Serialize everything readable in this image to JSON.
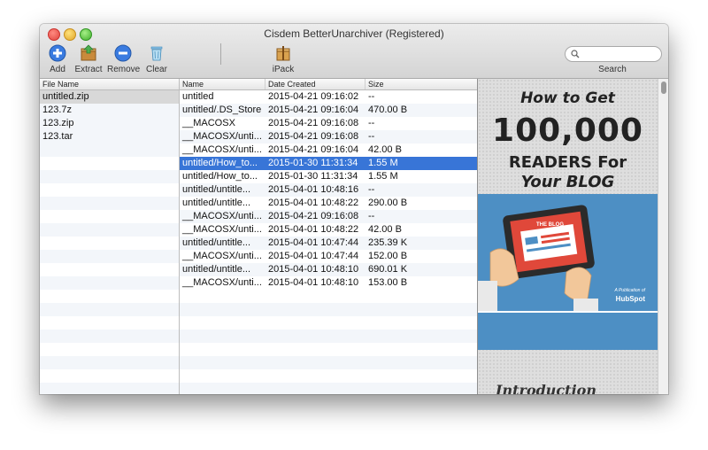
{
  "window": {
    "title": "Cisdem BetterUnarchiver (Registered)"
  },
  "toolbar": {
    "add_label": "Add",
    "extract_label": "Extract",
    "remove_label": "Remove",
    "clear_label": "Clear",
    "ipack_label": "iPack",
    "search_label": "Search",
    "search_value": ""
  },
  "archives": {
    "header": "File Name",
    "items": [
      "untitled.zip",
      "123.7z",
      "123.zip",
      "123.tar"
    ],
    "selected_index": 0
  },
  "files": {
    "headers": {
      "name": "Name",
      "date": "Date Created",
      "size": "Size"
    },
    "selected_index": 5,
    "rows": [
      {
        "name": "untitled",
        "date": "2015-04-21 09:16:02",
        "size": "--"
      },
      {
        "name": "untitled/.DS_Store",
        "date": "2015-04-21 09:16:04",
        "size": "470.00 B"
      },
      {
        "name": "__MACOSX",
        "date": "2015-04-21 09:16:08",
        "size": "--"
      },
      {
        "name": "__MACOSX/unti...",
        "date": "2015-04-21 09:16:08",
        "size": "--"
      },
      {
        "name": "__MACOSX/unti...",
        "date": "2015-04-21 09:16:04",
        "size": "42.00 B"
      },
      {
        "name": "untitled/How_to...",
        "date": "2015-01-30 11:31:34",
        "size": "1.55 M"
      },
      {
        "name": "untitled/How_to...",
        "date": "2015-01-30 11:31:34",
        "size": "1.55 M"
      },
      {
        "name": "untitled/untitle...",
        "date": "2015-04-01 10:48:16",
        "size": "--"
      },
      {
        "name": "untitled/untitle...",
        "date": "2015-04-01 10:48:22",
        "size": "290.00 B"
      },
      {
        "name": "__MACOSX/unti...",
        "date": "2015-04-21 09:16:08",
        "size": "--"
      },
      {
        "name": "__MACOSX/unti...",
        "date": "2015-04-01 10:48:22",
        "size": "42.00 B"
      },
      {
        "name": "untitled/untitle...",
        "date": "2015-04-01 10:47:44",
        "size": "235.39 K"
      },
      {
        "name": "__MACOSX/unti...",
        "date": "2015-04-01 10:47:44",
        "size": "152.00 B"
      },
      {
        "name": "untitled/untitle...",
        "date": "2015-04-01 10:48:10",
        "size": "690.01 K"
      },
      {
        "name": "__MACOSX/unti...",
        "date": "2015-04-01 10:48:10",
        "size": "153.00 B"
      }
    ]
  },
  "preview": {
    "line1": "How to Get",
    "line2": "100,000",
    "line3": "READERS For",
    "line4": "Your BLOG",
    "tablet_text": "THE BLOG",
    "publication_text": "A Publication of",
    "brand_text": "HubSpot",
    "intro_text": "Introduction"
  },
  "colors": {
    "selection_blue": "#3875d7",
    "preview_blue": "#4d8fc4",
    "tablet_red": "#e0483a"
  }
}
